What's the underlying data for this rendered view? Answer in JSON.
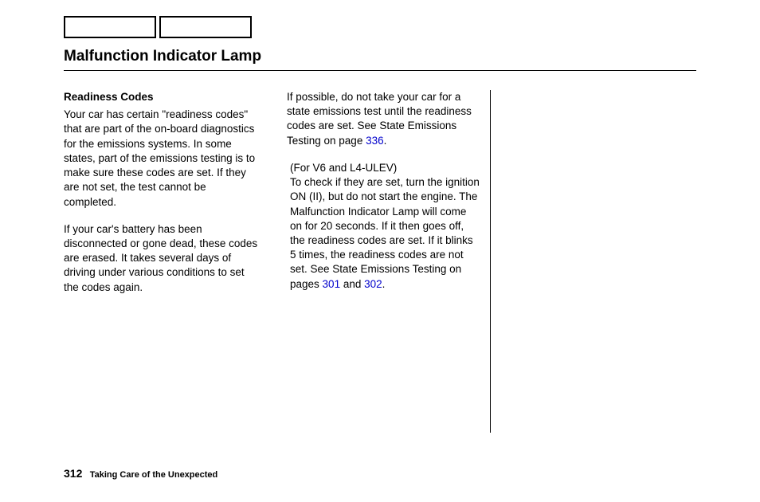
{
  "header": {
    "title": "Malfunction Indicator Lamp"
  },
  "column1": {
    "subheading": "Readiness Codes",
    "para1": "Your car has certain \"readiness codes\" that are part of the on-board diagnostics for the emissions systems. In some states, part of the emissions testing is to make sure these codes are set. If they are not set, the test cannot be completed.",
    "para2": "If your car's battery has been disconnected or gone dead, these codes are erased. It takes several days of driving under various conditions to set the codes again."
  },
  "column2": {
    "para1_a": "If possible, do not take your car for a state emissions test until the readiness codes are set. See State Emissions Testing on page ",
    "para1_link": "336",
    "para1_b": ".",
    "para2_note": "(For V6 and L4-ULEV)",
    "para2_a": "To check if they are set, turn the ignition ON (II), but do not start the engine. The Malfunction Indicator Lamp will come on for 20 seconds. If it then goes off, the readiness codes are set. If it blinks 5 times, the readiness codes are not set. See State Emissions Testing on pages ",
    "para2_link1": "301",
    "para2_mid": " and ",
    "para2_link2": "302",
    "para2_b": "."
  },
  "footer": {
    "page": "312",
    "section": "Taking Care of the Unexpected"
  }
}
